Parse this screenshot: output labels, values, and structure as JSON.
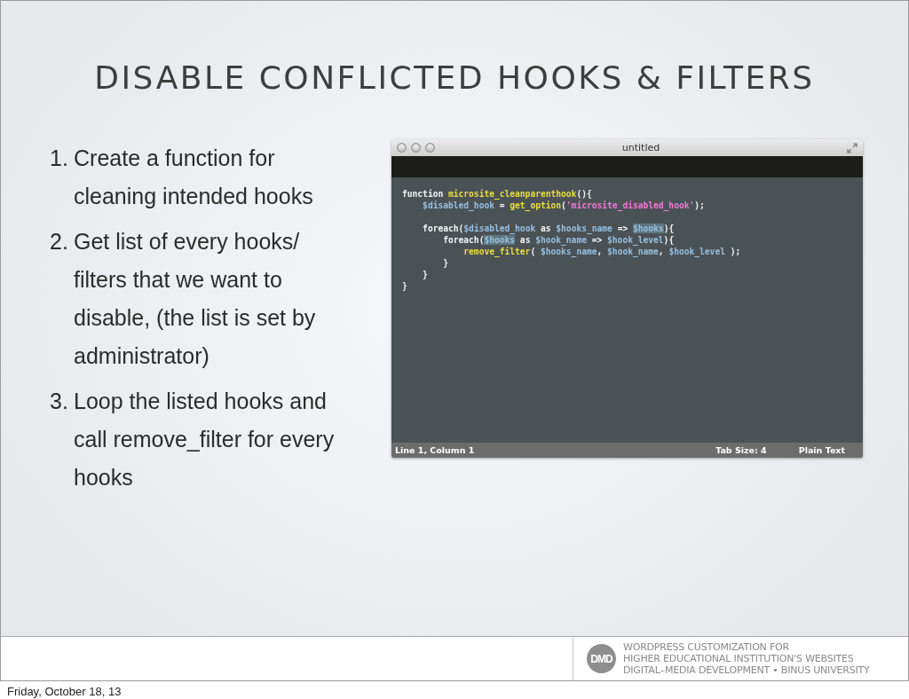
{
  "slide": {
    "title": "DISABLE CONFLICTED HOOKS & FILTERS",
    "steps": [
      {
        "number": "1.",
        "text": "Create a function for cleaning intended hooks"
      },
      {
        "number": "2.",
        "text": "Get list of every hooks/ filters that we want to disable, (the list is set by administrator)"
      },
      {
        "number": "3.",
        "text": "Loop the listed hooks and call remove_filter for every hooks"
      }
    ],
    "editor": {
      "title": "untitled",
      "code_lines": [
        [
          {
            "kind": "keyword",
            "text": "function "
          },
          {
            "kind": "function",
            "text": "microsite_cleanparenthook"
          },
          {
            "kind": "plain",
            "text": "(){"
          }
        ],
        [
          {
            "kind": "variable",
            "text": "    $disabled_hook"
          },
          {
            "kind": "plain",
            "text": " = "
          },
          {
            "kind": "function",
            "text": "get_option"
          },
          {
            "kind": "plain",
            "text": "("
          },
          {
            "kind": "string",
            "text": "'microsite_disabled_hook'"
          },
          {
            "kind": "plain",
            "text": ");"
          }
        ],
        [
          {
            "kind": "keyword",
            "text": "\n    foreach"
          },
          {
            "kind": "plain",
            "text": "("
          },
          {
            "kind": "variable",
            "text": "$disabled_hook"
          },
          {
            "kind": "keyword",
            "text": " as "
          },
          {
            "kind": "variable",
            "text": "$hooks_name"
          },
          {
            "kind": "plain",
            "text": " => "
          },
          {
            "kind": "highlight",
            "text": "$hooks"
          },
          {
            "kind": "plain",
            "text": "){"
          }
        ],
        [
          {
            "kind": "keyword",
            "text": "        foreach"
          },
          {
            "kind": "plain",
            "text": "("
          },
          {
            "kind": "highlight",
            "text": "$hooks"
          },
          {
            "kind": "keyword",
            "text": " as "
          },
          {
            "kind": "variable",
            "text": "$hook_name"
          },
          {
            "kind": "plain",
            "text": " => "
          },
          {
            "kind": "variable",
            "text": "$hook_level"
          },
          {
            "kind": "plain",
            "text": "){"
          }
        ],
        [
          {
            "kind": "function",
            "text": "            remove_filter"
          },
          {
            "kind": "plain",
            "text": "( "
          },
          {
            "kind": "variable",
            "text": "$hooks_name"
          },
          {
            "kind": "plain",
            "text": ", "
          },
          {
            "kind": "variable",
            "text": "$hook_name"
          },
          {
            "kind": "plain",
            "text": ", "
          },
          {
            "kind": "variable",
            "text": "$hook_level"
          },
          {
            "kind": "plain",
            "text": " );"
          }
        ],
        [
          {
            "kind": "plain",
            "text": "        }"
          }
        ],
        [
          {
            "kind": "plain",
            "text": "    }"
          }
        ],
        [
          {
            "kind": "plain",
            "text": "}"
          }
        ]
      ],
      "status_bar": {
        "position": "Line 1, Column 1",
        "tab_size": "Tab Size: 4",
        "syntax": "Plain Text"
      }
    },
    "footer": {
      "logo_text": "DMD",
      "lines": [
        "WORDPRESS CUSTOMIZATION FOR",
        "HIGHER EDUCATIONAL INSTITUTION'S WEBSITES",
        "DIGITAL–MEDIA DEVELOPMENT • BINUS UNIVERSITY"
      ]
    }
  },
  "print_footer": "Friday, October 18, 13"
}
